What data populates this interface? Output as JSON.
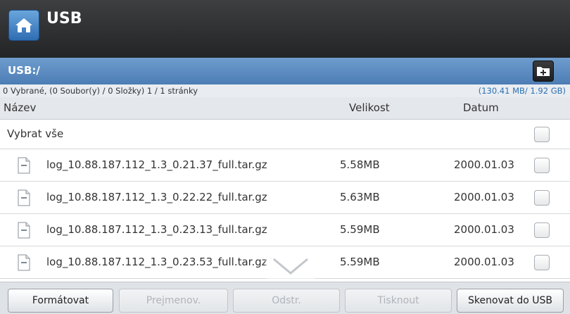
{
  "header": {
    "title": "USB",
    "home_icon": "home-icon"
  },
  "path_bar": {
    "path": "USB:/",
    "new_folder_icon": "add-folder-icon"
  },
  "info_bar": {
    "selection": "0 Vybrané, (0 Soubor(y) / 0 Složky) 1 / 1 stránky",
    "capacity": "(130.41 MB/ 1.92 GB)"
  },
  "columns": {
    "name": "Název",
    "size": "Velikost",
    "date": "Datum"
  },
  "select_all": {
    "label": "Vybrat vše",
    "checked": false
  },
  "files": [
    {
      "name": "log_10.88.187.112_1.3_0.21.37_full.tar.gz",
      "size": "5.58MB",
      "date": "2000.01.03",
      "checked": false
    },
    {
      "name": "log_10.88.187.112_1.3_0.22.22_full.tar.gz",
      "size": "5.63MB",
      "date": "2000.01.03",
      "checked": false
    },
    {
      "name": "log_10.88.187.112_1.3_0.23.13_full.tar.gz",
      "size": "5.59MB",
      "date": "2000.01.03",
      "checked": false
    },
    {
      "name": "log_10.88.187.112_1.3_0.23.53_full.tar.gz",
      "size": "5.59MB",
      "date": "2000.01.03",
      "checked": false
    }
  ],
  "buttons": {
    "format": "Formátovat",
    "rename": "Prejmenov.",
    "delete": "Odstr.",
    "print": "Tisknout",
    "scan": "Skenovat do USB"
  },
  "colors": {
    "accent": "#4c7db4",
    "title_bar": "#2b2c2e",
    "capacity_text": "#2d6fb0"
  }
}
